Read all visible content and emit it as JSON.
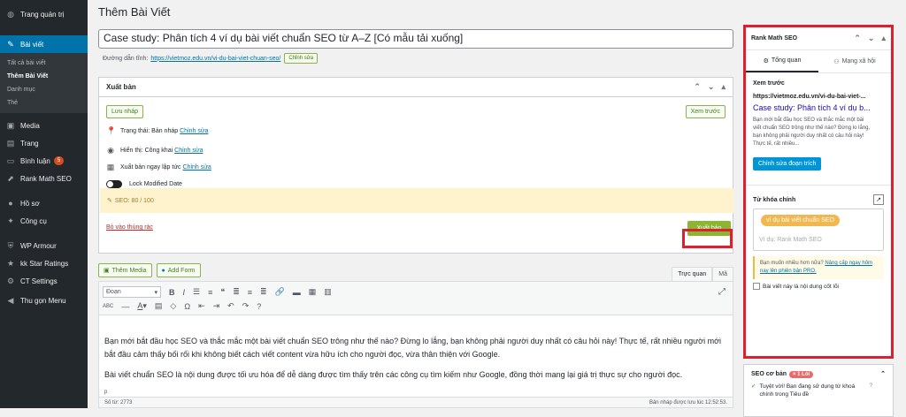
{
  "menu": {
    "dashboard": "Trang quản trị",
    "posts": "Bài viết",
    "posts_sub": [
      "Tất cả bài viết",
      "Thêm Bài Viết",
      "Danh mục",
      "Thẻ"
    ],
    "media": "Media",
    "pages": "Trang",
    "comments": "Bình luận",
    "comments_count": "5",
    "rankmath": "Rank Math SEO",
    "profile": "Hồ sơ",
    "tools": "Công cụ",
    "wparmour": "WP Armour",
    "kkstar": "kk Star Ratings",
    "ct": "CT Settings",
    "collapse": "Thu gọn Menu"
  },
  "page": {
    "title": "Thêm Bài Viết",
    "post_title": "Case study: Phân tích 4 ví dụ bài viết chuẩn SEO từ A–Z [Có mẫu tải xuống]",
    "permalink_label": "Đường dẫn tĩnh:",
    "permalink_url": "https://vietmoz.edu.vn/vi-du-bai-viet-chuan-seo/",
    "edit_permalink": "Chỉnh sửa"
  },
  "publish": {
    "title": "Xuất bản",
    "save_draft": "Lưu nháp",
    "preview": "Xem trước",
    "status": "Trạng thái: Bản nháp",
    "status_edit": "Chỉnh sửa",
    "visibility": "Hiển thị: Công khai",
    "visibility_edit": "Chỉnh sửa",
    "schedule": "Xuất bản ngay lập tức",
    "schedule_edit": "Chỉnh sửa",
    "lock": "Lock Modified Date",
    "seo": "SEO: 80 / 100",
    "trash": "Bỏ vào thùng rác",
    "publish_btn": "Xuất bản"
  },
  "editor": {
    "add_media": "Thêm Media",
    "add_form": "Add Form",
    "tab_visual": "Trực quan",
    "tab_text": "Mã",
    "format": "Đoạn",
    "paragraph1": "Bạn mới bắt đầu học SEO và thắc mắc một bài viết chuẩn SEO trông như thế nào? Đừng lo lắng, bạn không phải người duy nhất có câu hỏi này! Thực tế, rất nhiều người mới bắt đầu cảm thấy bối rối khi không biết cách viết content vừa hữu ích cho người đọc, vừa thân thiện với Google.",
    "paragraph2": "Bài viết chuẩn SEO là nội dung được tối ưu hóa để dễ dàng được tìm thấy trên các công cụ tìm kiếm như Google, đồng thời mang lại giá trị thực sự cho người đọc.",
    "path": "p",
    "word_count": "Số từ: 2773",
    "saved": "Bản nháp được lưu lúc 12:52:53."
  },
  "rankmath": {
    "title": "Rank Math SEO",
    "tab_general": "Tổng quan",
    "tab_social": "Mạng xã hội",
    "preview_label": "Xem trước",
    "preview_url": "https://vietmoz.edu.vn/vi-du-bai-viet-...",
    "preview_title": "Case study: Phân tích 4 ví dụ b...",
    "preview_desc": "Bạn mới bắt đầu học SEO và thắc mắc một bài viết chuẩn SEO trông như thế nào? Đừng lo lắng, bạn không phải người duy nhất có câu hỏi này! Thực tế, rất nhiều...",
    "edit_snippet": "Chỉnh sửa đoạn trích",
    "focus_kw_label": "Từ khóa chính",
    "focus_kw": "ví dụ bài viết chuẩn SEO",
    "kw_placeholder": "Ví dụ: Rank Math SEO",
    "upsell_text": "Bạn muốn nhiều hơn nữa?",
    "upsell_link": "Nâng cấp ngay hôm nay lên phiên bản PRO.",
    "pillar": "Bài viết này là nội dung cốt lõi",
    "basic_seo": "SEO cơ bản",
    "basic_badge": "× 1 Lỗi",
    "basic_item": "Tuyệt vời! Bạn đang sử dụng từ khoá chính trong Tiêu đề"
  },
  "colors": {
    "accent": "#0073aa",
    "rank_red": "#dd2030",
    "publish": "#8bb532"
  }
}
